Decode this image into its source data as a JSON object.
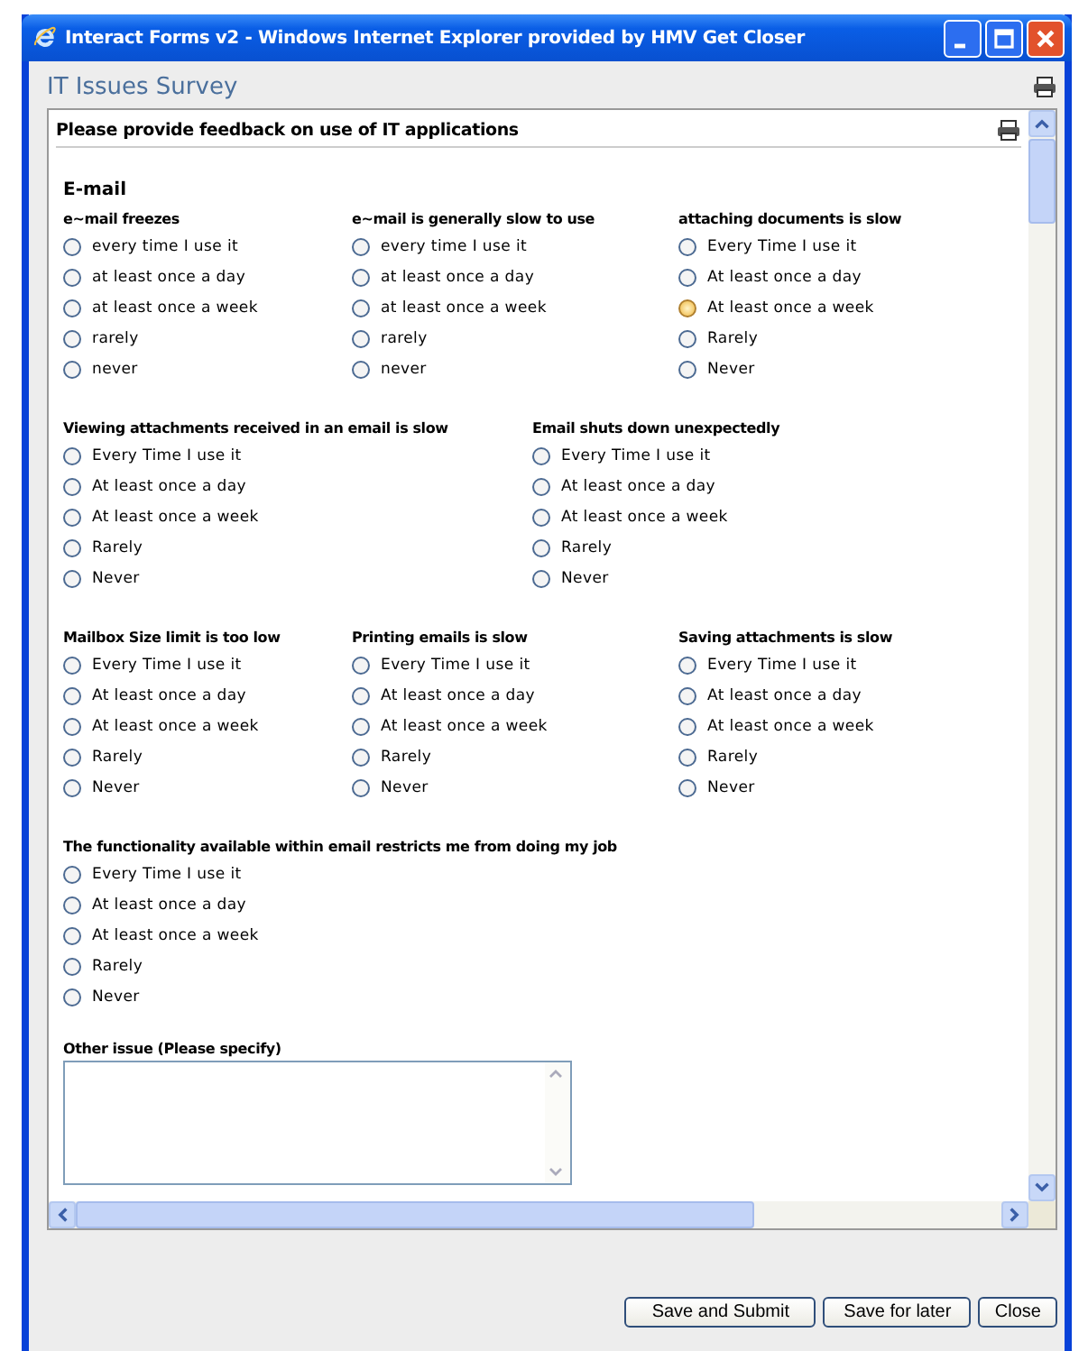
{
  "window": {
    "title": "Interact Forms v2 - Windows Internet Explorer provided by HMV Get Closer"
  },
  "page_title": "IT Issues Survey",
  "form": {
    "heading": "Please provide feedback on use of IT applications",
    "section": "E-mail",
    "rows": [
      [
        {
          "question": "e~mail freezes",
          "options": [
            {
              "label": "every time I use it",
              "selected": false,
              "hovered": false
            },
            {
              "label": "at least once a day",
              "selected": false,
              "hovered": false
            },
            {
              "label": "at least once a week",
              "selected": false,
              "hovered": false
            },
            {
              "label": "rarely",
              "selected": false,
              "hovered": false
            },
            {
              "label": "never",
              "selected": false,
              "hovered": false
            }
          ]
        },
        {
          "question": "e~mail is generally slow to use",
          "options": [
            {
              "label": "every time I use it",
              "selected": false,
              "hovered": false
            },
            {
              "label": "at least once a day",
              "selected": false,
              "hovered": false
            },
            {
              "label": "at least once a week",
              "selected": false,
              "hovered": false
            },
            {
              "label": "rarely",
              "selected": false,
              "hovered": false
            },
            {
              "label": "never",
              "selected": false,
              "hovered": false
            }
          ]
        },
        {
          "question": "attaching documents is slow",
          "options": [
            {
              "label": "Every Time I use it",
              "selected": false,
              "hovered": false
            },
            {
              "label": "At least once a day",
              "selected": false,
              "hovered": false
            },
            {
              "label": "At least once a week",
              "selected": false,
              "hovered": true
            },
            {
              "label": "Rarely",
              "selected": false,
              "hovered": false
            },
            {
              "label": "Never",
              "selected": false,
              "hovered": false
            }
          ]
        }
      ],
      [
        {
          "question": "Viewing attachments received in an email is slow",
          "options": [
            {
              "label": "Every Time I use it",
              "selected": false,
              "hovered": false
            },
            {
              "label": "At least once a day",
              "selected": false,
              "hovered": false
            },
            {
              "label": "At least once a week",
              "selected": false,
              "hovered": false
            },
            {
              "label": "Rarely",
              "selected": false,
              "hovered": false
            },
            {
              "label": "Never",
              "selected": false,
              "hovered": false
            }
          ]
        },
        {
          "question": "Email shuts down unexpectedly",
          "options": [
            {
              "label": "Every Time I use it",
              "selected": false,
              "hovered": false
            },
            {
              "label": "At least once a day",
              "selected": false,
              "hovered": false
            },
            {
              "label": "At least once a week",
              "selected": false,
              "hovered": false
            },
            {
              "label": "Rarely",
              "selected": false,
              "hovered": false
            },
            {
              "label": "Never",
              "selected": false,
              "hovered": false
            }
          ]
        }
      ],
      [
        {
          "question": "Mailbox Size limit is too low",
          "options": [
            {
              "label": "Every Time I use it",
              "selected": false,
              "hovered": false
            },
            {
              "label": "At least once a day",
              "selected": false,
              "hovered": false
            },
            {
              "label": "At least once a week",
              "selected": false,
              "hovered": false
            },
            {
              "label": "Rarely",
              "selected": false,
              "hovered": false
            },
            {
              "label": "Never",
              "selected": false,
              "hovered": false
            }
          ]
        },
        {
          "question": "Printing emails is slow",
          "options": [
            {
              "label": "Every Time I use it",
              "selected": false,
              "hovered": false
            },
            {
              "label": "At least once a day",
              "selected": false,
              "hovered": false
            },
            {
              "label": "At least once a week",
              "selected": false,
              "hovered": false
            },
            {
              "label": "Rarely",
              "selected": false,
              "hovered": false
            },
            {
              "label": "Never",
              "selected": false,
              "hovered": false
            }
          ]
        },
        {
          "question": "Saving attachments is slow",
          "options": [
            {
              "label": "Every Time I use it",
              "selected": false,
              "hovered": false
            },
            {
              "label": "At least once a day",
              "selected": false,
              "hovered": false
            },
            {
              "label": "At least once a week",
              "selected": false,
              "hovered": false
            },
            {
              "label": "Rarely",
              "selected": false,
              "hovered": false
            },
            {
              "label": "Never",
              "selected": false,
              "hovered": false
            }
          ]
        }
      ],
      [
        {
          "question": "The functionality available within email restricts me from doing my job",
          "options": [
            {
              "label": "Every Time I use it",
              "selected": false,
              "hovered": false
            },
            {
              "label": "At least once a day",
              "selected": false,
              "hovered": false
            },
            {
              "label": "At least once a week",
              "selected": false,
              "hovered": false
            },
            {
              "label": "Rarely",
              "selected": false,
              "hovered": false
            },
            {
              "label": "Never",
              "selected": false,
              "hovered": false
            }
          ]
        }
      ]
    ],
    "other_label": "Other issue (Please specify)"
  },
  "buttons": [
    "Save and Submit",
    "Save for later",
    "Close"
  ]
}
